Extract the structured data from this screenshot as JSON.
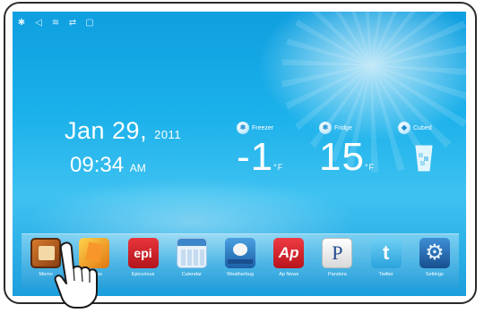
{
  "status_bar": {
    "icons": [
      "bluetooth-icon",
      "speaker-icon",
      "wifi-icon",
      "network-icon",
      "sd-card-icon"
    ]
  },
  "clock": {
    "date": "Jan 29,",
    "year": "2011",
    "time": "09:34",
    "ampm": "AM"
  },
  "zones": [
    {
      "name": "Freezer",
      "value": "-1",
      "unit": "°F"
    },
    {
      "name": "Fridge",
      "value": "15",
      "unit": "°F"
    },
    {
      "name": "Cubed",
      "icon": "ice-cup-icon"
    }
  ],
  "dock": {
    "apps": [
      {
        "label": "Memo",
        "icon": "memo-icon",
        "color": "#b75a1f"
      },
      {
        "label": "Photos",
        "icon": "photos-icon",
        "color": "#f6a21a"
      },
      {
        "label": "Epicurious",
        "icon": "epicurious-icon",
        "color": "#d8222a"
      },
      {
        "label": "Calendar",
        "icon": "calendar-icon",
        "color": "#3d86c9"
      },
      {
        "label": "Weatherbug",
        "icon": "weatherbug-icon",
        "color": "#2e7fc6"
      },
      {
        "label": "Ap News",
        "icon": "ap-news-icon",
        "color": "#e0262f"
      },
      {
        "label": "Pandora",
        "icon": "pandora-icon",
        "color": "#f2f2f2"
      },
      {
        "label": "Twitter",
        "icon": "twitter-icon",
        "color": "#3fb6e8"
      },
      {
        "label": "Settings",
        "icon": "settings-icon",
        "color": "#2a73b8"
      }
    ]
  }
}
